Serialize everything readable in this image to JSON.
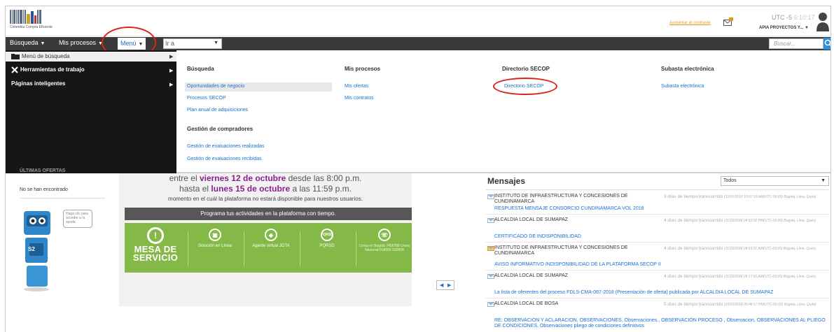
{
  "header": {
    "logo_text": "Colombia Compra Eficiente",
    "contrast_link": "Aumentar el contraste",
    "utc_label": "UTC -5",
    "clock": "6:10:17",
    "user_name": "APIA PROYECTOS Y...",
    "user_caret": "▼"
  },
  "menubar": {
    "busqueda": "Búsqueda",
    "mis_procesos": "Mis procesos",
    "menu": "Menú",
    "ira": "Ir a",
    "search_placeholder": "Buscar..."
  },
  "leftmenu": {
    "items": [
      "Menú de búsqueda",
      "Herramientas de trabajo",
      "Páginas inteligentes"
    ]
  },
  "dropdown": {
    "busqueda_head": "Búsqueda",
    "busqueda_links": [
      "Oportunidades de negocio",
      "Procesos SECOP",
      "Plan anual de adquisiciones"
    ],
    "gestion_head": "Gestión de compradores",
    "gestion_links": [
      "Gestión de evaluaciones realizadas",
      "Gestión de evaluaciones recibidas"
    ],
    "misprocesos_head": "Mis procesos",
    "misprocesos_links": [
      "Mis ofertas",
      "Mis contratos"
    ],
    "directorio_head": "Directorio SECOP",
    "directorio_link": "Directorio SECOP",
    "subasta_head": "Subasta electrónica",
    "subasta_link": "Subasta electrónica"
  },
  "left_col": {
    "title": "ÚLTIMAS OFERTAS",
    "empty": "No se han encontrado",
    "bubble": "Haga clic para acceder a la ayuda",
    "robot_badge": "S2"
  },
  "notice": {
    "l1_a": "entre el ",
    "l1_b": "viernes 12 de octubre",
    "l1_c": " desde las 8:00 p.m.",
    "l2_a": "hasta el ",
    "l2_b": "lunes 15 de octubre",
    "l2_c": " a las 11:59 p.m.",
    "l3": "momento en el cuál la plataforma no estará disponible para nuestros usuarios.",
    "banner": "Programa tus actividades en la plataforma con tiempo.",
    "mesa_1": "MESA DE",
    "mesa_2": "SERVICIO",
    "cells": [
      {
        "label": "Solución en Línea"
      },
      {
        "label": "Agente virtual JOTA"
      },
      {
        "label": "PQRSD"
      },
      {
        "label": "Línea en Bogotá 7456788 Línea Nacional 018000 520808"
      }
    ]
  },
  "mensajes": {
    "title": "Mensajes",
    "filter": "Todos",
    "items": [
      {
        "from": "INSTITUTO DE INFRAESTRUCTURA Y CONCESIONES DE CUNDINAMARCA",
        "time": "3 días de tiempo transcurrido",
        "time_detail": "(12/10/2018 10:07:19 AM(UTC-05:00) Bogotá, Lima, Quito)",
        "subject": "RESPUESTA MENSAJE CONSORCIO CUNDINAMARCA VOL 2018"
      },
      {
        "from": "ALCALDIA LOCAL DE SUMAPAZ",
        "time": "4 días de tiempo transcurrido",
        "time_detail": "(11/10/2018 04:52:02 PM(UTC-05:00) Bogotá, Lima, Quito)",
        "subject": "CERTIFICADO DE INDISPONIBILIDAD"
      },
      {
        "from": "INSTITUTO DE INFRAESTRUCTURA Y CONCESIONES DE CUNDINAMARCA",
        "time": "4 días de tiempo transcurrido",
        "time_detail": "(11/10/2018 09:59:21 AM(UTC-05:00) Bogotá, Lima, Quito)",
        "subject": "AVISO INFORMATIVO INDISPONIBILIDAD DE LA PLATAFORMA SECOP II"
      },
      {
        "from": "ALCALDIA LOCAL DE SUMAPAZ",
        "time": "4 días de tiempo transcurrido",
        "time_detail": "(11/10/2018 09:17:56 AM(UTC-05:00) Bogotá, Lima, Quito)",
        "subject": "La lista de oferentes del proceso FDLS-CMA-067-2018 (Presentación de oferta) publicada por ALCALDIA LOCAL DE SUMAPAZ"
      },
      {
        "from": "ALCALDIA LOCAL DE BOSA",
        "time": "5 días de tiempo transcurrido",
        "time_detail": "(10/10/2018 05:48:17 PM(UTC-05:00) Bogotá, Lima, Quito)",
        "subject": "RE: OBSERVACION Y ACLARACION, OBSERVACIONES, Observaciones., OBSERVACIÓN PROCESO , Observacion, OBSERVACIONES AL PLIEGO DE CONDICIONES, Observaciones pliego de condiciones definitivos"
      }
    ]
  }
}
